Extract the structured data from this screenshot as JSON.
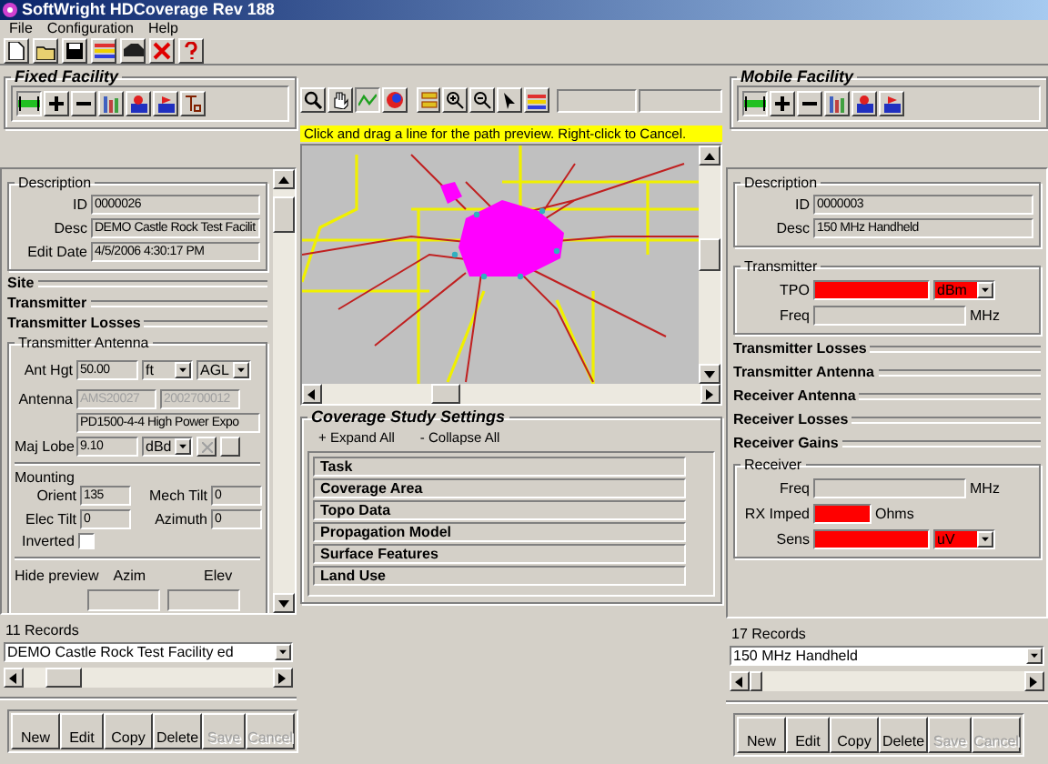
{
  "window": {
    "title": "SoftWright HDCoverage Rev 188"
  },
  "menu": [
    "File",
    "Configuration",
    "Help"
  ],
  "fixed_facility": {
    "title": "Fixed Facility",
    "description": {
      "title": "Description",
      "fields": [
        {
          "label": "ID",
          "value": "0000026"
        },
        {
          "label": "Desc",
          "value": "DEMO Castle Rock Test Facilit"
        },
        {
          "label": "Edit Date",
          "value": "4/5/2006 4:30:17 PM"
        }
      ]
    },
    "sections": [
      "Site",
      "Transmitter",
      "Transmitter Losses"
    ],
    "antenna": {
      "title": "Transmitter Antenna",
      "ant_hgt": {
        "label": "Ant Hgt",
        "value": "50.00",
        "unit": "ft",
        "reference": "AGL"
      },
      "antenna": {
        "label": "Antenna",
        "codes": [
          {
            "value": "AMS20027",
            "disabled": true
          },
          {
            "value": "2002700012",
            "disabled": true
          }
        ],
        "name": "PD1500-4-4 High Power Expo"
      },
      "maj_lobe": {
        "label": "Maj Lobe",
        "value": "9.10",
        "unit": "dBd"
      },
      "mounting": {
        "title": "Mounting",
        "fields": [
          {
            "label": "Orient",
            "value": "135"
          },
          {
            "label": "Mech Tilt",
            "value": "0"
          },
          {
            "label": "Elec Tilt",
            "value": "0"
          },
          {
            "label": "Azimuth",
            "value": "0"
          }
        ]
      },
      "inverted": {
        "label": "Inverted",
        "checked": false
      },
      "preview": {
        "label": "Hide preview",
        "columns": [
          "Azim",
          "Elev"
        ]
      }
    },
    "records": "11 Records",
    "selected_record": "DEMO Castle Rock Test Facility ed",
    "buttons": [
      {
        "label": "New",
        "disabled": false
      },
      {
        "label": "Edit",
        "disabled": false
      },
      {
        "label": "Copy",
        "disabled": false
      },
      {
        "label": "Delete",
        "disabled": false
      },
      {
        "label": "Save",
        "disabled": true
      },
      {
        "label": "Cancel",
        "disabled": true
      }
    ]
  },
  "map": {
    "hint": "Click and drag a line for the path preview.  Right-click to Cancel."
  },
  "coverage": {
    "title": "Coverage Study Settings",
    "actions": [
      "+ Expand All",
      "- Collapse All"
    ],
    "sections": [
      "Task",
      "Coverage Area",
      "Topo Data",
      "Propagation Model",
      "Surface Features",
      "Land Use"
    ]
  },
  "mobile_facility": {
    "title": "Mobile Facility",
    "description": {
      "title": "Description",
      "fields": [
        {
          "label": "ID",
          "value": "0000003"
        },
        {
          "label": "Desc",
          "value": "150 MHz Handheld"
        }
      ]
    },
    "transmitter": {
      "title": "Transmitter",
      "rows": [
        {
          "kind": "select",
          "label": "TPO",
          "unit": "dBm",
          "invalid": true
        },
        {
          "kind": "text",
          "label": "Freq",
          "unit": "MHz",
          "invalid": false
        }
      ]
    },
    "sections": [
      "Transmitter Losses",
      "Transmitter Antenna",
      "Receiver Antenna",
      "Receiver Losses",
      "Receiver Gains"
    ],
    "receiver": {
      "title": "Receiver",
      "rows": [
        {
          "kind": "text",
          "label": "Freq",
          "unit": "MHz",
          "invalid": false
        },
        {
          "kind": "text",
          "label": "RX Imped",
          "unit": "Ohms",
          "invalid": true
        },
        {
          "kind": "select",
          "label": "Sens",
          "unit": "uV",
          "invalid": true
        }
      ]
    },
    "records": "17 Records",
    "selected_record": "150 MHz Handheld",
    "buttons": [
      {
        "label": "New",
        "disabled": false
      },
      {
        "label": "Edit",
        "disabled": false
      },
      {
        "label": "Copy",
        "disabled": false
      },
      {
        "label": "Delete",
        "disabled": false
      },
      {
        "label": "Save",
        "disabled": true
      },
      {
        "label": "Cancel",
        "disabled": true
      }
    ]
  }
}
